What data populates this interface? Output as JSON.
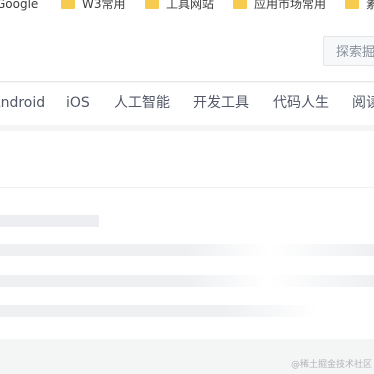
{
  "bookmarks": [
    {
      "label": "Google",
      "icon": "google-icon"
    },
    {
      "label": "W3常用",
      "icon": "folder-icon"
    },
    {
      "label": "工具网站",
      "icon": "folder-icon"
    },
    {
      "label": "应用市场常用",
      "icon": "folder-icon"
    },
    {
      "label": "素",
      "icon": "folder-icon"
    }
  ],
  "search": {
    "placeholder": "探索掘金"
  },
  "nav": {
    "items": [
      "Android",
      "iOS",
      "人工智能",
      "开发工具",
      "代码人生",
      "阅读"
    ]
  },
  "watermark": "@稀土掘金技术社区",
  "colors": {
    "page_bg": "#f4f5f5",
    "text": "#515767",
    "skeleton": "#eef0f2",
    "folder": "#f7cb4d"
  }
}
